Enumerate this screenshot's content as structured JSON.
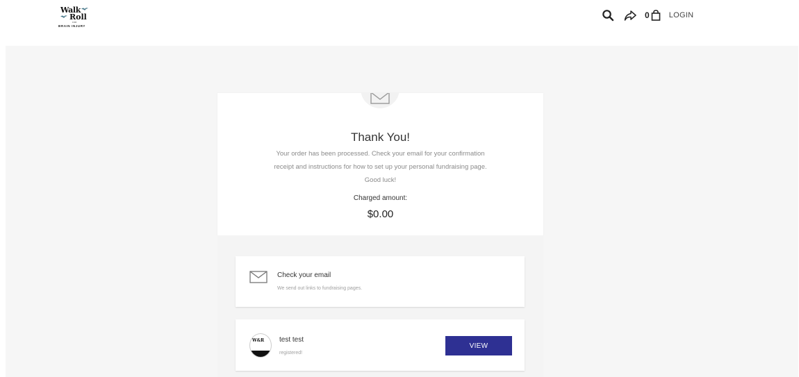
{
  "header": {
    "logo": {
      "line1": "Walk",
      "line2": "Roll",
      "line3": "FOR",
      "line4": "BRAIN INJURY"
    },
    "cart_count": "0",
    "login_label": "LOGIN",
    "icons": [
      "search-icon",
      "share-icon",
      "shopping-bag-icon"
    ]
  },
  "confirmation": {
    "title": "Thank You!",
    "message": "Your order has been processed. Check your email for your confirmation receipt and instructions for how to set up your personal fundraising page. Good luck!",
    "charged_label": "Charged amount:",
    "charged_amount": "$0.00"
  },
  "email_box": {
    "title": "Check your email",
    "subtitle": "We send out links to fundraising pages."
  },
  "registrant": {
    "name": "test test",
    "status": "registered!",
    "view_label": "VIEW"
  },
  "colors": {
    "primary_button": "#2e3093",
    "page_background": "#f6f6f6"
  }
}
